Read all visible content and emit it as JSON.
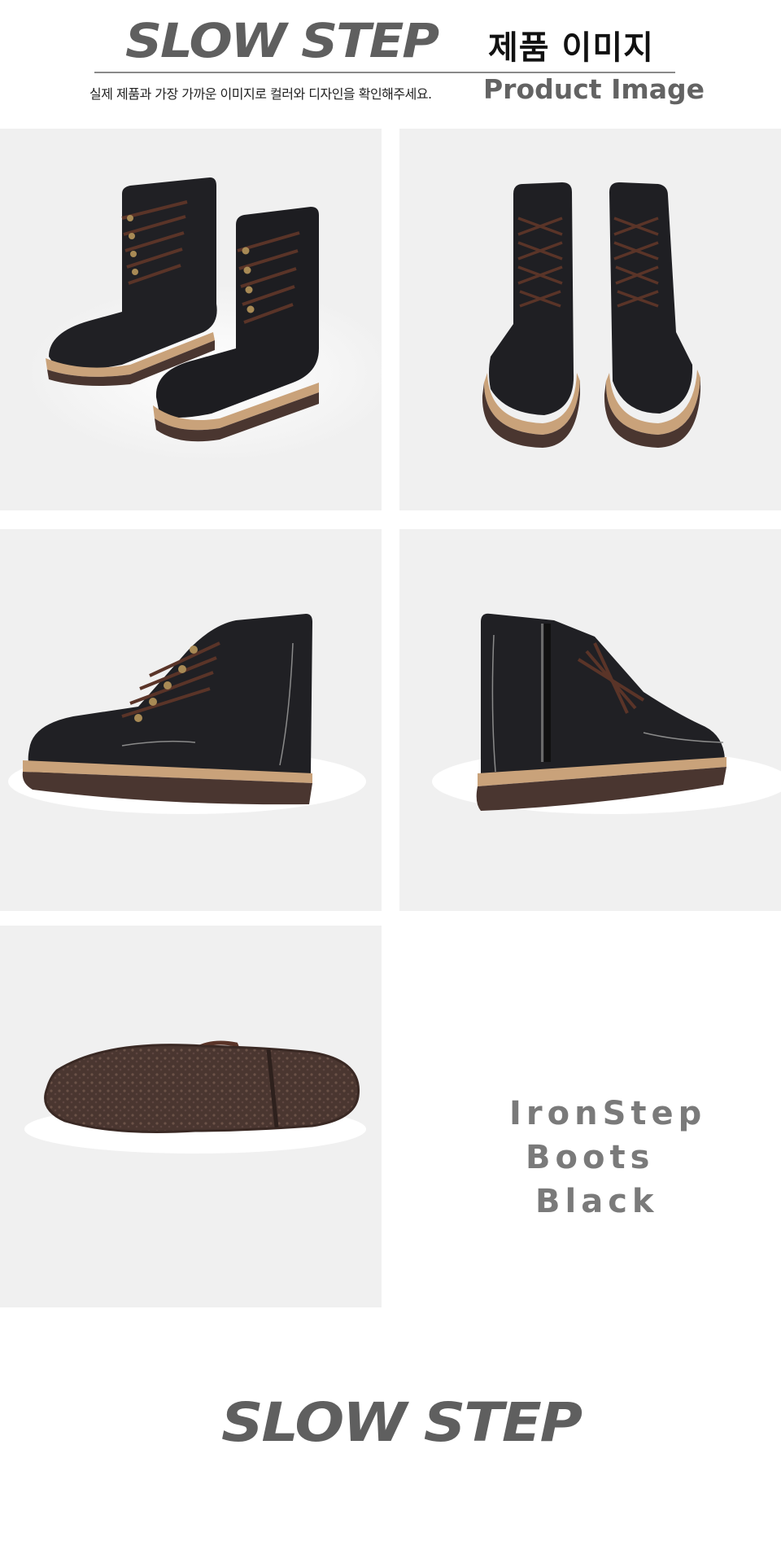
{
  "header": {
    "logo_text": "SLOW STEP",
    "title_ko": "제품 이미지",
    "subtitle_ko": "실제 제품과 가장 가까운 이미지로 컬러와 디자인을 확인해주세요.",
    "title_en": "Product Image"
  },
  "product": {
    "name_line1": "IronStep",
    "name_line2": "Boots",
    "name_line3": "Black"
  },
  "footer": {
    "logo_text": "SLOW STEP"
  },
  "colors": {
    "logo_gray": "#5f5f5f",
    "tile_bg": "#f0f0f0",
    "boot_leather": "#222226",
    "sole_brown": "#4a3630",
    "welt_tan": "#c9a27a",
    "product_name_gray": "#7a7a7a"
  }
}
